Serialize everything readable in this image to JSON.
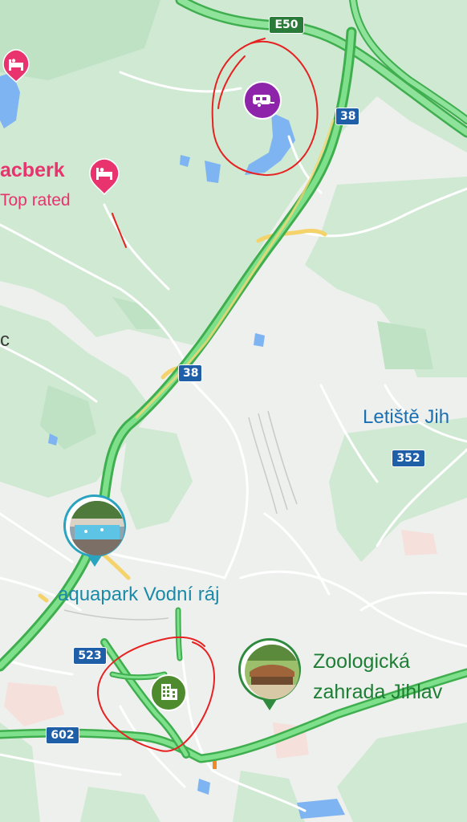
{
  "map": {
    "road_shields": {
      "e50": "E50",
      "r38_top": "38",
      "r38_mid": "38",
      "r352": "352",
      "r523": "523",
      "r602": "602"
    },
    "places": {
      "hotel_name": "acberk",
      "hotel_tag": "Top rated",
      "edge_letter": "c",
      "airport": "Letiště Jih",
      "aquapark": "aquapark Vodní ráj",
      "zoo_line1": "Zoologická",
      "zoo_line2": "zahrada Jihlav"
    },
    "icons": {
      "hotel": "hotel-bed-icon",
      "campground": "caravan-icon",
      "building": "office-building-icon"
    },
    "colors": {
      "highway": "#5ed36d",
      "land": "#eef0ee",
      "forest": "#cfe9d2",
      "water": "#7fb4f2",
      "hotel": "#e8336e",
      "campground": "#8e24aa",
      "place_label": "#1b6fb3",
      "zoo_label": "#1e7e34",
      "annotation": "#e62222"
    }
  }
}
